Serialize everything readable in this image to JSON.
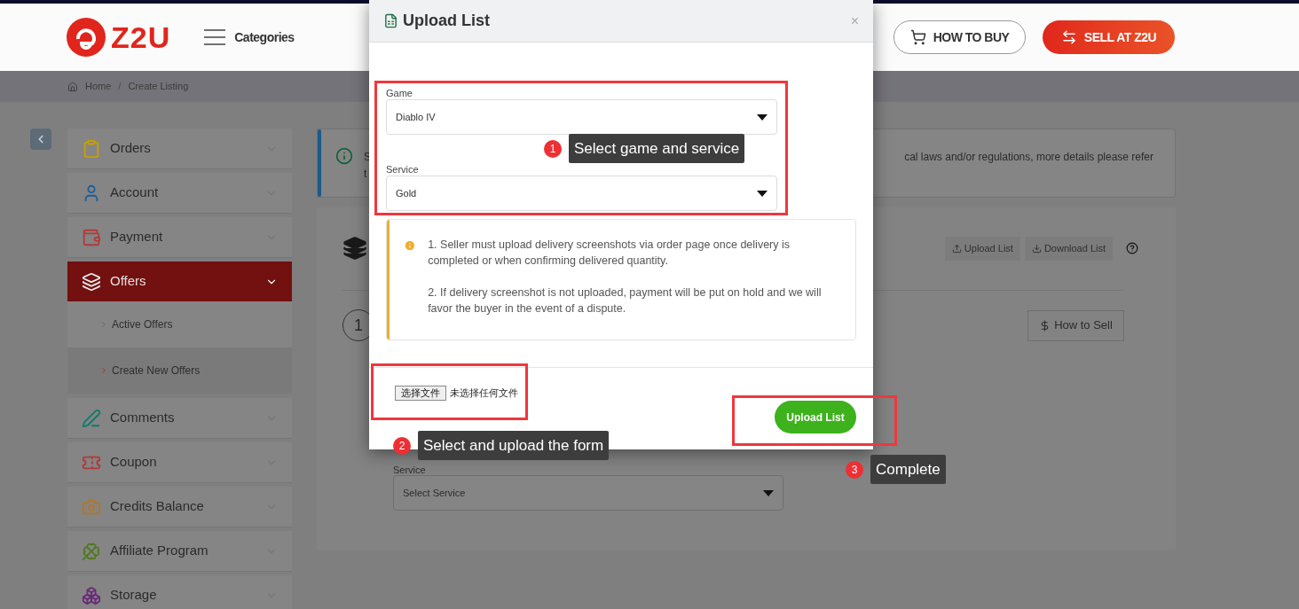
{
  "header": {
    "logo": "Z2U",
    "categories": "Categories",
    "buttons": [
      {
        "label": "HOW TO BUY",
        "kind": "outline"
      },
      {
        "label": "SELL AT Z2U",
        "kind": "primary"
      }
    ]
  },
  "breadcrumb": [
    "Home",
    "/",
    "Create Listing"
  ],
  "sidebar": {
    "items": [
      {
        "label": "Orders",
        "selected": false
      },
      {
        "label": "Account",
        "selected": false
      },
      {
        "label": "Payment",
        "selected": false
      },
      {
        "label": "Offers",
        "selected": true,
        "children": [
          {
            "label": "Active Offers",
            "selected": false
          },
          {
            "label": "Create New Offers",
            "selected": true
          }
        ]
      },
      {
        "label": "Comments",
        "selected": false
      },
      {
        "label": "Coupon",
        "selected": false
      },
      {
        "label": "Credits Balance",
        "selected": false
      },
      {
        "label": "Affiliate Program",
        "selected": false
      },
      {
        "label": "Storage",
        "selected": false
      }
    ]
  },
  "notice": {
    "text_left": [
      "S",
      "t"
    ],
    "text_right": "cal laws and/or regulations, more details please refer"
  },
  "toolbar": {
    "buttons": [
      "Upload List",
      "Download List"
    ]
  },
  "step": "1",
  "how_to_sell": "How to Sell",
  "service_field": {
    "label": "Service",
    "placeholder": "Select Service"
  },
  "modal": {
    "title": "Upload List",
    "close": "×",
    "fields": [
      {
        "label": "Game",
        "value": "Diablo IV"
      },
      {
        "label": "Service",
        "value": "Gold"
      }
    ],
    "notes": [
      "1. Seller must upload delivery screenshots via order page once delivery is completed or when confirming delivered quantity.",
      "2. If delivery screenshot is not uploaded, payment will be put on hold and we will favor the buyer in the event of a dispute."
    ],
    "file": {
      "button": "选择文件",
      "status": "未选择任何文件"
    },
    "submit": "Upload List"
  },
  "annotations": [
    {
      "number": "1",
      "text": "Select game and service"
    },
    {
      "number": "2",
      "text": "Select and upload the form"
    },
    {
      "number": "3",
      "text": "Complete"
    }
  ]
}
